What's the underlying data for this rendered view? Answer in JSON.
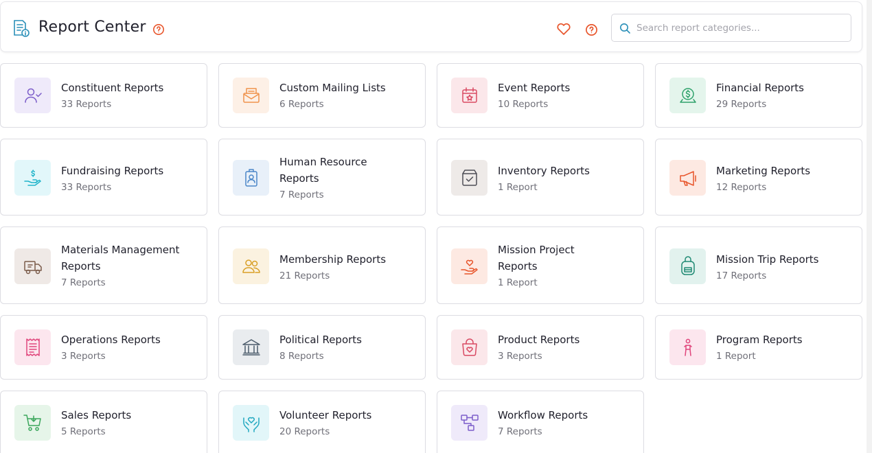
{
  "header": {
    "title": "Report Center",
    "search_placeholder": "Search report categories..."
  },
  "colors": {
    "accent": "#e8552b",
    "brand": "#2a8fb8"
  },
  "categories": [
    {
      "name": "Constituent Reports",
      "count": "33 Reports",
      "icon": "user-check-icon",
      "color": "#7b5cc9",
      "bg": "#efeafa"
    },
    {
      "name": "Custom Mailing Lists",
      "count": "6 Reports",
      "icon": "mail-icon",
      "color": "#f0924b",
      "bg": "#fdf0e6"
    },
    {
      "name": "Event Reports",
      "count": "10 Reports",
      "icon": "calendar-star-icon",
      "color": "#d94a63",
      "bg": "#fbe7ea"
    },
    {
      "name": "Financial Reports",
      "count": "29 Reports",
      "icon": "money-icon",
      "color": "#2ea26b",
      "bg": "#e4f5ec"
    },
    {
      "name": "Fundraising Reports",
      "count": "33 Reports",
      "icon": "hand-dollar-icon",
      "color": "#1fb3c9",
      "bg": "#e2f7fa"
    },
    {
      "name": "Human Resource Reports",
      "count": "7 Reports",
      "icon": "id-badge-icon",
      "color": "#4a86c8",
      "bg": "#e8f0f9"
    },
    {
      "name": "Inventory Reports",
      "count": "1 Report",
      "icon": "box-check-icon",
      "color": "#4d4d55",
      "bg": "#eeeae8"
    },
    {
      "name": "Marketing Reports",
      "count": "12 Reports",
      "icon": "megaphone-icon",
      "color": "#e8552b",
      "bg": "#fde9e2"
    },
    {
      "name": "Materials Management Reports",
      "count": "7 Reports",
      "icon": "truck-icon",
      "color": "#7a5a48",
      "bg": "#efe9e6"
    },
    {
      "name": "Membership Reports",
      "count": "21 Reports",
      "icon": "users-icon",
      "color": "#d9a026",
      "bg": "#fbf2e0"
    },
    {
      "name": "Mission Project Reports",
      "count": "1 Report",
      "icon": "hand-heart-icon",
      "color": "#e8552b",
      "bg": "#fde9e2"
    },
    {
      "name": "Mission Trip Reports",
      "count": "17 Reports",
      "icon": "backpack-icon",
      "color": "#1f8a73",
      "bg": "#e2f2ee"
    },
    {
      "name": "Operations Reports",
      "count": "3 Reports",
      "icon": "receipt-icon",
      "color": "#e0457b",
      "bg": "#fce6ee"
    },
    {
      "name": "Political Reports",
      "count": "8 Reports",
      "icon": "bank-icon",
      "color": "#4b5b6b",
      "bg": "#e9ecef"
    },
    {
      "name": "Product Reports",
      "count": "3 Reports",
      "icon": "bag-heart-icon",
      "color": "#d94a63",
      "bg": "#fbe7ea"
    },
    {
      "name": "Program Reports",
      "count": "1 Report",
      "icon": "person-icon",
      "color": "#e0457b",
      "bg": "#fce6ee"
    },
    {
      "name": "Sales Reports",
      "count": "5 Reports",
      "icon": "cart-icon",
      "color": "#3aa65b",
      "bg": "#e6f5e9"
    },
    {
      "name": "Volunteer Reports",
      "count": "20 Reports",
      "icon": "hands-heart-icon",
      "color": "#1fa7bf",
      "bg": "#e2f6f9"
    },
    {
      "name": "Workflow Reports",
      "count": "7 Reports",
      "icon": "workflow-icon",
      "color": "#7b5cc9",
      "bg": "#efeafa"
    }
  ]
}
